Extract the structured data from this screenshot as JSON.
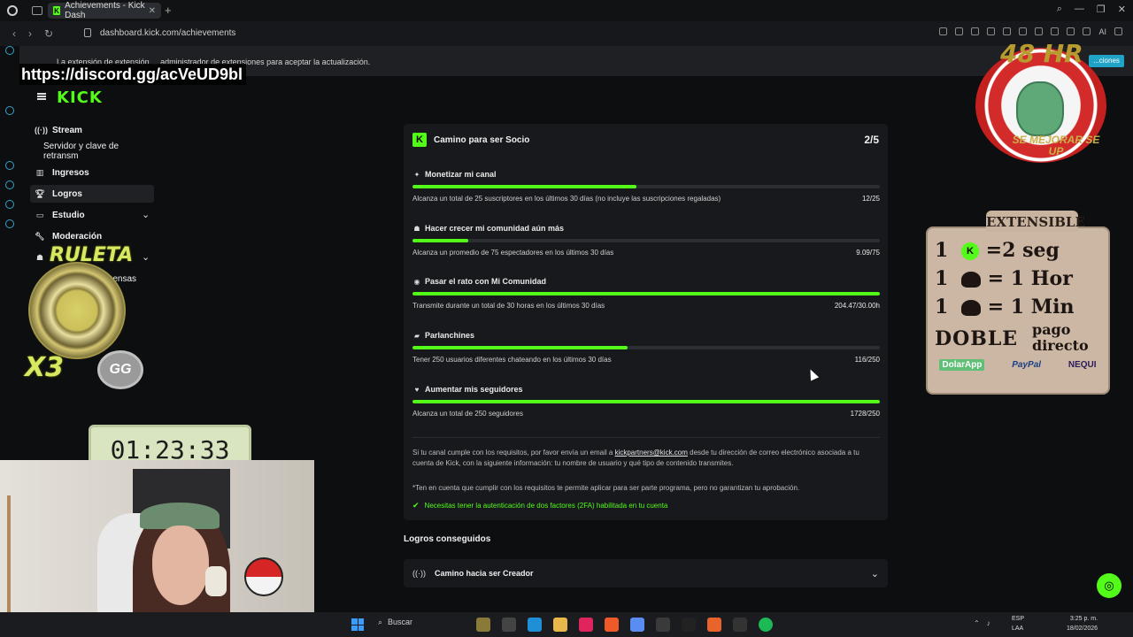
{
  "browser": {
    "tab_title": "Achievements - Kick Dash",
    "url": "dashboard.kick.com/achievements",
    "ai_label": "AI"
  },
  "extension_notice": {
    "text": "La extensión de extensión ... administrador de extensiones para aceptar la actualización.",
    "button_label": "...ciones"
  },
  "overlay": {
    "discord": "https://discord.gg/acVeUD9bl",
    "badge_top": "48 HR",
    "badge_bottom": "SE MEJORAR SE UP",
    "extensible_title": "EXTENSIBLE",
    "extensible_rows": [
      {
        "n": "1",
        "value": "=2 seg"
      },
      {
        "n": "1",
        "value": "= 1 Hor"
      },
      {
        "n": "1",
        "value": "= 1 Min"
      }
    ],
    "doble": "DOBLE",
    "pago": "pago directo",
    "payments": [
      "DolarApp",
      "PayPal",
      "NEQUI"
    ],
    "ruleta": "RULETA",
    "x3": "X3",
    "gg": "GG",
    "timer": "01:23:33"
  },
  "sidebar": {
    "logo": "KICK",
    "items": [
      {
        "label": "Stream",
        "icon": "broadcast-icon"
      },
      {
        "label": "Servidor y clave de retransm",
        "icon": ""
      },
      {
        "label": "Ingresos",
        "icon": "chart-icon"
      },
      {
        "label": "Logros",
        "icon": "trophy-icon"
      },
      {
        "label": "Estudio",
        "icon": "monitor-icon"
      },
      {
        "label": "Moderación",
        "icon": "wrench-icon"
      },
      {
        "label": "...ensas",
        "icon": ""
      }
    ]
  },
  "card": {
    "title": "Camino para ser Socio",
    "count": "2/5",
    "goals": [
      {
        "title": "Monetizar mi canal",
        "icon": "sparkle-icon",
        "progress": 0.48,
        "desc": "Alcanza un total de 25 suscriptores en los últimos 30 días (no incluye las suscripciones regaladas)",
        "value": "12/25"
      },
      {
        "title": "Hacer crecer mi comunidad aún más",
        "icon": "people-icon",
        "progress": 0.12,
        "desc": "Alcanza un promedio de 75 espectadores en los últimos 30 días",
        "value": "9.09/75"
      },
      {
        "title": "Pasar el rato con Mi Comunidad",
        "icon": "broadcast-icon",
        "progress": 1.0,
        "desc": "Transmite durante un total de 30 horas en los últimos 30 días",
        "value": "204.47/30.00h"
      },
      {
        "title": "Parlanchines",
        "icon": "chat-icon",
        "progress": 0.46,
        "desc": "Tener 250 usuarios diferentes chateando en los últimos 30 días",
        "value": "116/250"
      },
      {
        "title": "Aumentar mis seguidores",
        "icon": "heart-icon",
        "progress": 1.0,
        "desc": "Alcanza un total de 250 seguidores",
        "value": "1728/250"
      }
    ],
    "info_before_link": "Si tu canal cumple con los requisitos, por favor envía un email a ",
    "info_link": "kickpartners@kick.com",
    "info_after_link": " desde tu dirección de correo electrónico asociada a tu cuenta de Kick, con la siguiente información: tu nombre de usuario y qué tipo de contenido transmites.",
    "note": "*Ten en cuenta que cumplir con los requisitos te permite aplicar para ser parte programa, pero no garantizan tu aprobación.",
    "twofa": "Necesitas tener la autenticación de dos factores (2FA) habilitada en tu cuenta"
  },
  "achieved": {
    "heading": "Logros conseguidos",
    "item": "Camino hacia ser Creador"
  },
  "taskbar": {
    "search": "Buscar",
    "lang_1": "ESP",
    "lang_2": "LAA",
    "time": "3:25 p. m.",
    "date": "18/02/2026"
  },
  "colors": {
    "accent": "#53fc18",
    "card_bg": "#17191c",
    "page_bg": "#0d0e10"
  }
}
